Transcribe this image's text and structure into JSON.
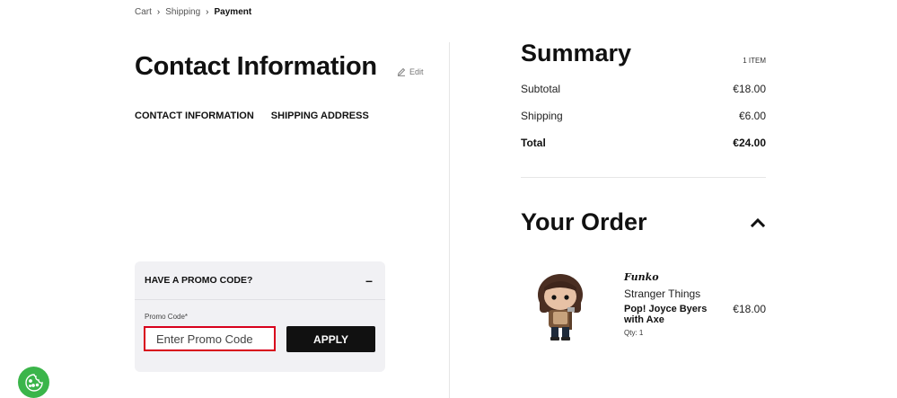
{
  "breadcrumb": {
    "items": [
      "Cart",
      "Shipping",
      "Payment"
    ],
    "separator": "›"
  },
  "contact": {
    "title": "Contact Information",
    "edit_label": "Edit",
    "tabs": [
      "CONTACT INFORMATION",
      "SHIPPING ADDRESS"
    ]
  },
  "promo": {
    "heading": "HAVE A PROMO CODE?",
    "toggle": "–",
    "field_label": "Promo Code*",
    "placeholder": "Enter Promo Code",
    "value": "",
    "apply_label": "APPLY"
  },
  "summary": {
    "title": "Summary",
    "item_count": "1 ITEM",
    "rows": [
      {
        "label": "Subtotal",
        "value": "€18.00"
      },
      {
        "label": "Shipping",
        "value": "€6.00"
      },
      {
        "label": "Total",
        "value": "€24.00"
      }
    ]
  },
  "order": {
    "title": "Your Order",
    "product": {
      "brand": "Funko",
      "series": "Stranger Things",
      "name": "Pop! Joyce Byers with Axe",
      "qty": "Qty: 1",
      "price": "€18.00"
    }
  },
  "colors": {
    "accent_error": "#d8001c",
    "button_dark": "#111111",
    "cookie_green": "#3bb54a",
    "panel_bg": "#f1f1f4"
  },
  "icons": {
    "edit": "pencil-icon",
    "collapse": "chevron-up-icon",
    "cookie": "cookie-icon"
  }
}
